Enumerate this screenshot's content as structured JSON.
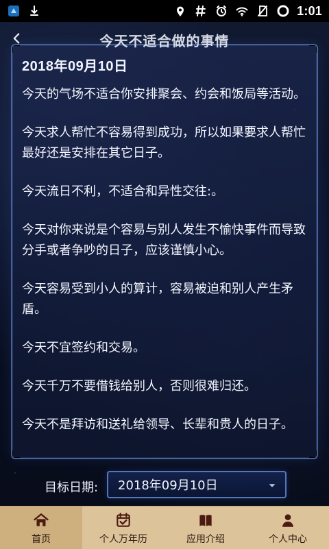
{
  "status_bar": {
    "time": "1:01"
  },
  "header": {
    "title": "今天不适合做的事情"
  },
  "content": {
    "date_heading": "2018年09月10日",
    "paragraphs": [
      "今天的气场不适合你安排聚会、约会和饭局等活动。",
      "今天求人帮忙不容易得到成功，所以如果要求人帮忙最好还是安排在其它日子。",
      "今天流日不利，不适合和异性交往:。",
      "今天对你来说是个容易与别人发生不愉快事件而导致分手或者争吵的日子，应该谨慎小心。",
      "今天容易受到小人的算计，容易被迫和别人产生矛盾。",
      "今天不宜签约和交易。",
      "今天千万不要借钱给别人，否则很难归还。",
      "今天不是拜访和送礼给领导、长辈和贵人的日子。"
    ]
  },
  "date_picker": {
    "label": "目标日期:",
    "value": "2018年09月10日"
  },
  "bottom_nav": {
    "items": [
      {
        "label": "首页",
        "icon": "home-icon",
        "active": true
      },
      {
        "label": "个人万年历",
        "icon": "calendar-icon",
        "active": false
      },
      {
        "label": "应用介绍",
        "icon": "book-icon",
        "active": false
      },
      {
        "label": "个人中心",
        "icon": "user-icon",
        "active": false
      }
    ]
  },
  "colors": {
    "nav_bg": "#dcc39a",
    "nav_active_bg": "#cdb07e",
    "nav_icon": "#4d1a12",
    "card_border": "#7f9ce6"
  }
}
